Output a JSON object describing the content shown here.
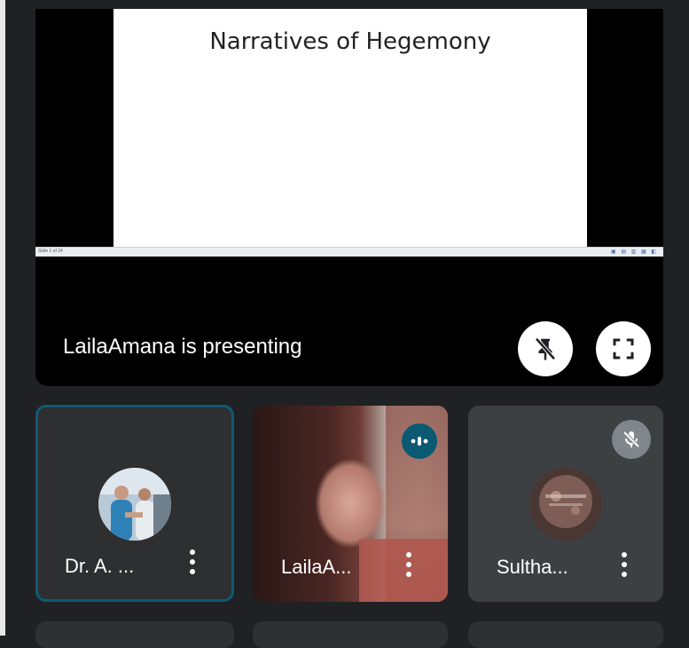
{
  "presentation": {
    "slide_title": "Narratives of Hegemony",
    "slide_counter": "Slide 1 of 24",
    "presenting_text": "LailaAmana is presenting"
  },
  "controls": {
    "unpin_icon": "pin-off-icon",
    "fullscreen_icon": "fullscreen-icon"
  },
  "participants": [
    {
      "name": "Dr. A. ...",
      "active_speaker_highlight": true,
      "avatar_icon": "profile-photo"
    },
    {
      "name": "LailaA...",
      "speaking_icon": "audio-level-icon",
      "video": true
    },
    {
      "name": "Sultha...",
      "muted_icon": "mic-off-icon",
      "avatar_icon": "profile-photo"
    }
  ],
  "colors": {
    "background": "#202124",
    "stage": "#000000",
    "tile": "#3c4043",
    "active_border": "#0e5a72",
    "speaking_badge": "#0b5a72",
    "muted_badge": "#80868b"
  }
}
